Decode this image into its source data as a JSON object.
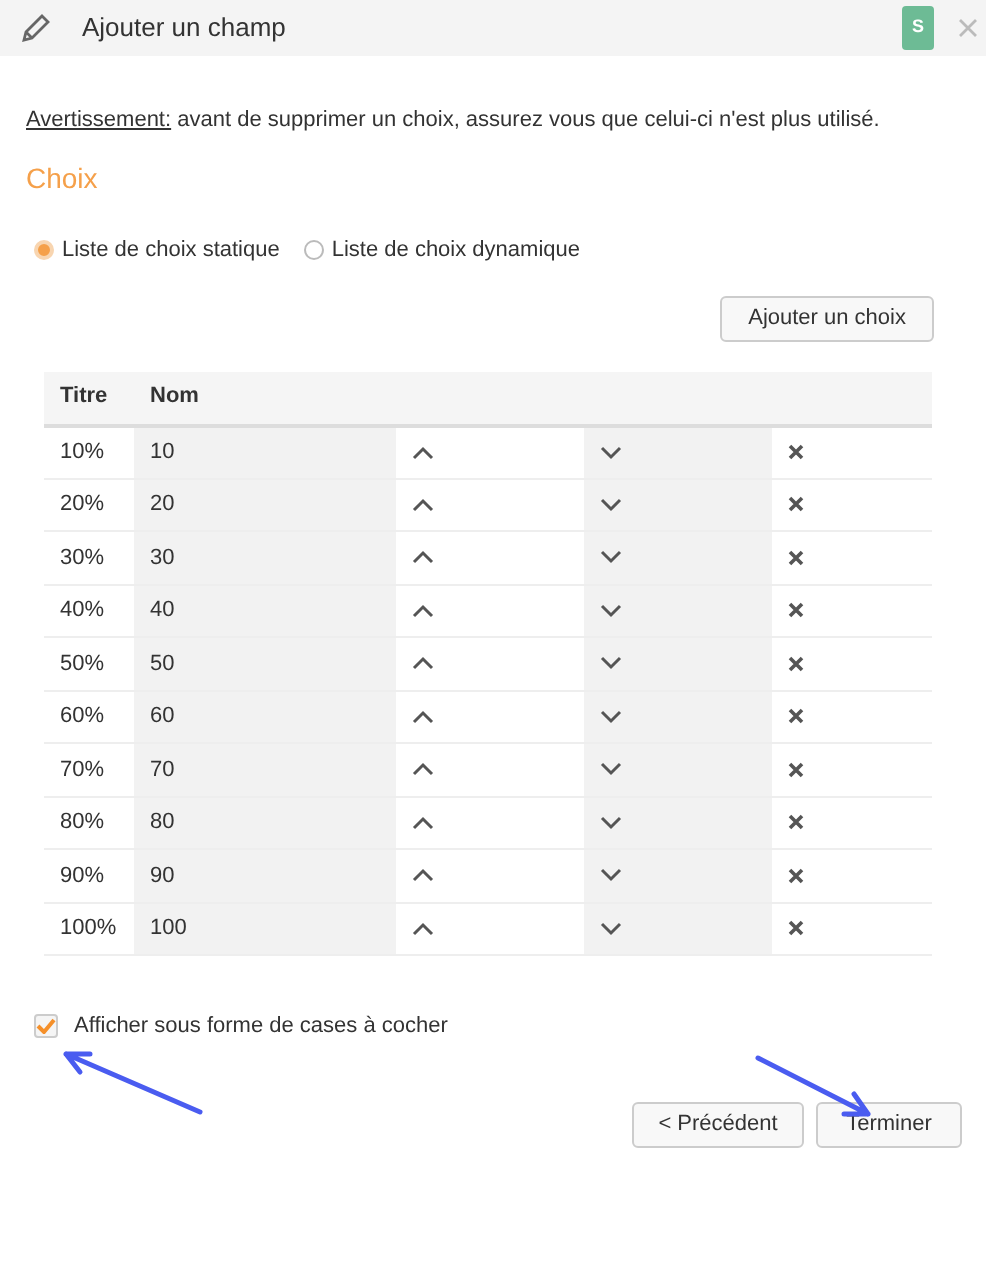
{
  "header": {
    "title": "Ajouter un champ",
    "badge": "S"
  },
  "warning": {
    "label": "Avertissement:",
    "text": "avant de supprimer un choix, assurez vous que celui-ci n'est plus utilisé."
  },
  "section_title": "Choix",
  "list_type": [
    {
      "label": "Liste de choix statique",
      "selected": true
    },
    {
      "label": "Liste de choix dynamique",
      "selected": false
    }
  ],
  "add_button": "Ajouter un choix",
  "table": {
    "columns": [
      "Titre",
      "Nom"
    ],
    "rows": [
      {
        "titre": "10%",
        "nom": "10"
      },
      {
        "titre": "20%",
        "nom": "20"
      },
      {
        "titre": "30%",
        "nom": "30"
      },
      {
        "titre": "40%",
        "nom": "40"
      },
      {
        "titre": "50%",
        "nom": "50"
      },
      {
        "titre": "60%",
        "nom": "60"
      },
      {
        "titre": "70%",
        "nom": "70"
      },
      {
        "titre": "80%",
        "nom": "80"
      },
      {
        "titre": "90%",
        "nom": "90"
      },
      {
        "titre": "100%",
        "nom": "100"
      }
    ]
  },
  "checkbox": {
    "label": "Afficher sous forme de cases à cocher",
    "checked": true
  },
  "buttons": [
    "< Précédent",
    "Terminer"
  ]
}
